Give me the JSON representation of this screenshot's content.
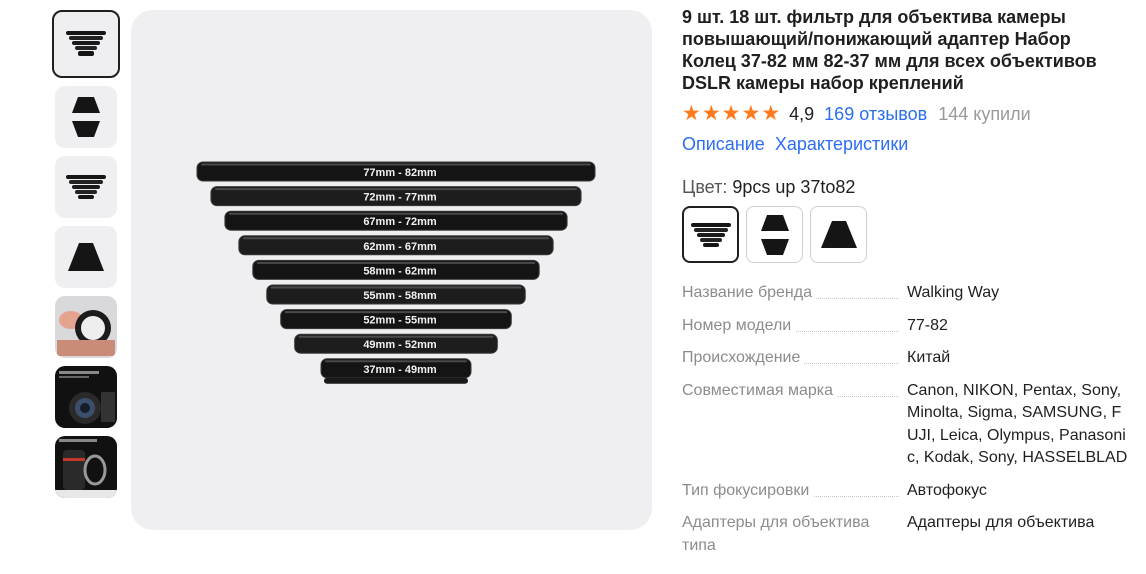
{
  "product": {
    "title": "9 шт. 18 шт. фильтр для объектива камеры повышающий/понижающий адаптер Набор Колец 37-82 мм 82-37 мм для всех объективов DSLR камеры набор креплений",
    "rating": "4,9",
    "reviews": "169 отзывов",
    "bought": "144 купили",
    "star_color": "#ff7a1a",
    "link_color": "#2b6ef0"
  },
  "tabs": {
    "description": "Описание",
    "characteristics": "Характеристики"
  },
  "color": {
    "label": "Цвет: ",
    "value": "9pcs up 37to82",
    "swatches": [
      "9pcs up 37to82",
      "9pcs up+down",
      "9pcs down 82to37"
    ]
  },
  "image": {
    "ring_labels": [
      "77mm - 82mm",
      "72mm - 77mm",
      "67mm - 72mm",
      "62mm - 67mm",
      "58mm - 62mm",
      "55mm - 58mm",
      "52mm - 55mm",
      "49mm - 52mm",
      "37mm - 49mm"
    ]
  },
  "specs": [
    {
      "key": "Название бренда",
      "value": "Walking Way"
    },
    {
      "key": "Номер модели",
      "value": "77-82"
    },
    {
      "key": "Происхождение",
      "value": "Китай"
    },
    {
      "key": "Совместимая марка",
      "value": "Canon, NIKON, Pentax, Sony, Minolta, Sigma, SAMSUNG, FUJI, Leica, Olympus, Panasonic, Kodak, Sony, HASSELBLAD"
    },
    {
      "key": "Тип фокусировки",
      "value": "Автофокус"
    },
    {
      "key": "Адаптеры для объектива типа",
      "value": "Адаптеры для объектива"
    }
  ]
}
